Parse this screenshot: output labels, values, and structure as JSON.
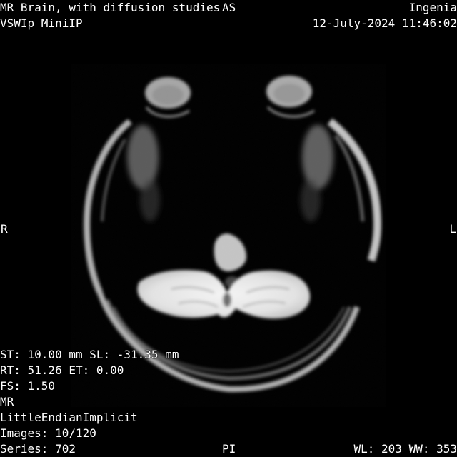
{
  "study": {
    "description": "MR Brain, with diffusion studies",
    "series_name": "VSWIp MiniIP"
  },
  "institution": "Ingenia",
  "datetime": "12-July-2024 11:46:02",
  "orientation": {
    "top": "AS",
    "left": "R",
    "right": "L",
    "bottom": "PI"
  },
  "acquisition": {
    "line1": "ST: 10.00 mm SL: -31.35 mm",
    "line2": "RT: 51.26 ET: 0.00",
    "line3": "FS: 1.50",
    "modality": "MR",
    "transfer_syntax": "LittleEndianImplicit",
    "images": "Images: 10/120",
    "series": "Series: 702"
  },
  "window": "WL: 203 WW: 353"
}
